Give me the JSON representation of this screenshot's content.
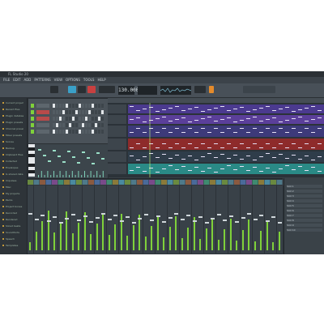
{
  "app": {
    "title": "FL Studio 20",
    "menu": [
      "FILE",
      "EDIT",
      "ADD",
      "PATTERNS",
      "VIEW",
      "OPTIONS",
      "TOOLS",
      "HELP"
    ]
  },
  "toolbar": {
    "tempo": "130.000",
    "colors": {
      "play": "#3aa0c8",
      "record": "#c84040",
      "accent": "#e58b2b"
    }
  },
  "browser": {
    "items": [
      "Current project",
      "Recent files",
      "Plugin database",
      "Plugin presets",
      "Channel presets",
      "Mixer presets",
      "Scores",
      "Backup",
      "Clipboard files",
      "Collected",
      "Envelopes",
      "IL shared data",
      "Impulses",
      "Misc",
      "My projects",
      "Packs",
      "Project bones",
      "Recorded",
      "Rendered",
      "Sliced beats",
      "Soundfonts",
      "Speech",
      "Templates"
    ]
  },
  "playlist": {
    "track_colors": [
      "#4b3a8f",
      "#5b3f9a",
      "#3d3a7a",
      "#8e2b2b",
      "#2f3d4a",
      "#2a8a86"
    ]
  },
  "mixer": {
    "strip_count": 42
  },
  "mixer_side": {
    "slots": [
      "Slot 1",
      "Slot 2",
      "Slot 3",
      "Slot 4",
      "Slot 5",
      "Slot 6",
      "Slot 7",
      "Slot 8",
      "Slot 9",
      "Slot 10"
    ]
  }
}
